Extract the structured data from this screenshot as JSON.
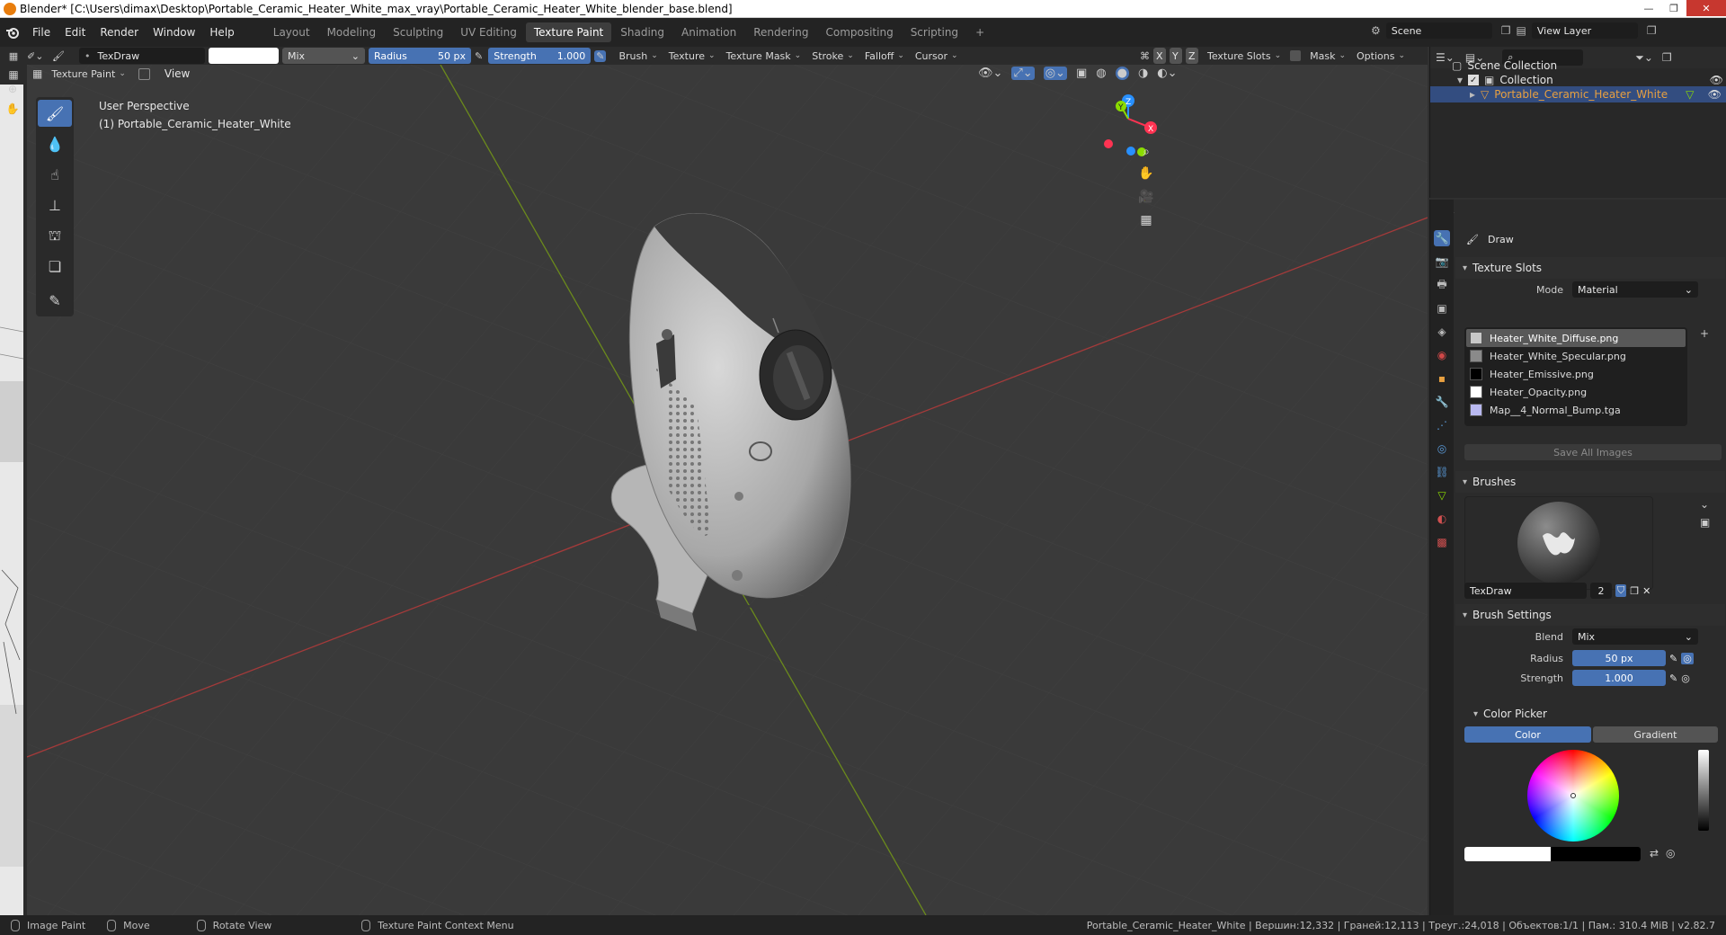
{
  "window": {
    "title": "Blender* [C:\\Users\\dimax\\Desktop\\Portable_Ceramic_Heater_White_max_vray\\Portable_Ceramic_Heater_White_blender_base.blend]",
    "min": "—",
    "max": "❐",
    "close": "✕"
  },
  "menu": [
    "File",
    "Edit",
    "Render",
    "Window",
    "Help"
  ],
  "workspaces": [
    "Layout",
    "Modeling",
    "Sculpting",
    "UV Editing",
    "Texture Paint",
    "Shading",
    "Animation",
    "Rendering",
    "Compositing",
    "Scripting",
    "+"
  ],
  "active_workspace": "Texture Paint",
  "scene": {
    "name": "Scene",
    "view_layer": "View Layer"
  },
  "toolheader": {
    "brush_name": "TexDraw",
    "blend": "Mix",
    "radius_label": "Radius",
    "radius_value": "50 px",
    "strength_label": "Strength",
    "strength_value": "1.000",
    "menus": [
      "Brush",
      "Texture",
      "Texture Mask",
      "Stroke",
      "Falloff",
      "Cursor"
    ],
    "axes": [
      "X",
      "Y",
      "Z"
    ],
    "right_menus": [
      "Texture Slots",
      "Mask",
      "Options"
    ]
  },
  "viewheader": {
    "mode": "Texture Paint",
    "view": "View"
  },
  "viewport": {
    "perspective": "User Perspective",
    "object": "(1) Portable_Ceramic_Heater_White",
    "gizmo": {
      "x": "X",
      "y": "Y",
      "z": "Z"
    }
  },
  "outliner": {
    "root": "Scene Collection",
    "collection": "Collection",
    "object": "Portable_Ceramic_Heater_White"
  },
  "properties": {
    "tool": "Draw",
    "texture_slots": {
      "title": "Texture Slots",
      "mode_label": "Mode",
      "mode_value": "Material",
      "slots": [
        {
          "name": "Heater_White_Diffuse.png",
          "color": "#c8c8c8"
        },
        {
          "name": "Heater_White_Specular.png",
          "color": "#8a8a8a"
        },
        {
          "name": "Heater_Emissive.png",
          "color": "#000000"
        },
        {
          "name": "Heater_Opacity.png",
          "color": "#ffffff"
        },
        {
          "name": "Map__4_Normal_Bump.tga",
          "color": "#b8b8f0"
        }
      ],
      "save_all": "Save All Images"
    },
    "brushes": {
      "title": "Brushes",
      "brush_name": "TexDraw",
      "users": "2"
    },
    "brush_settings": {
      "title": "Brush Settings",
      "blend_label": "Blend",
      "blend_value": "Mix",
      "radius_label": "Radius",
      "radius_value": "50 px",
      "strength_label": "Strength",
      "strength_value": "1.000"
    },
    "color_picker": {
      "title": "Color Picker",
      "tab_color": "Color",
      "tab_gradient": "Gradient"
    }
  },
  "statusbar": {
    "left": [
      {
        "label": "Image Paint"
      },
      {
        "label": "Move"
      },
      {
        "label": "Rotate View"
      },
      {
        "label": "Texture Paint Context Menu"
      }
    ],
    "stats": "Portable_Ceramic_Heater_White | Вершин:12,332 | Граней:12,113 | Треуг.:24,018 | Объектов:1/1 | Пам.: 310.4 MiB | v2.82.7"
  },
  "colors": {
    "accent": "#4772b3",
    "selected_object": "#e8a040",
    "axis_x": "#ff3352",
    "axis_y": "#8bdc00",
    "axis_z": "#2890ff"
  }
}
